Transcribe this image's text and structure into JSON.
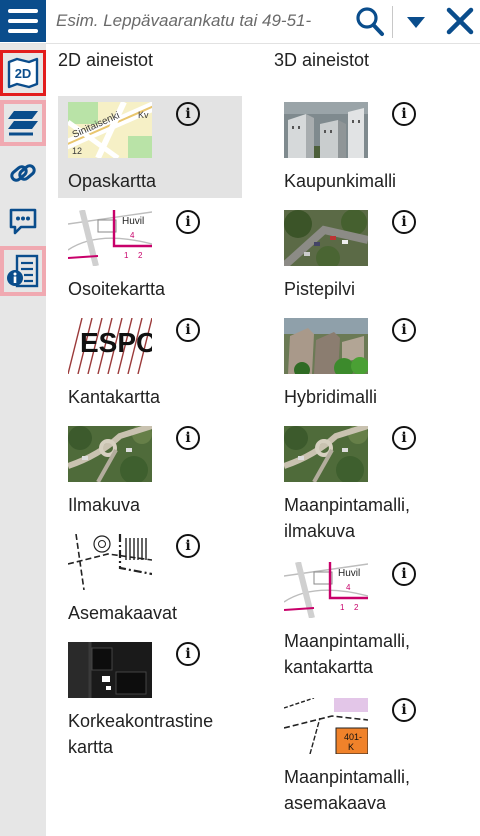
{
  "search": {
    "placeholder": "Esim. Leppävaarankatu tai 49-51-"
  },
  "icons": {
    "menu": "hamburger-menu-icon",
    "search": "magnifier-icon",
    "dropdown": "caret-down-icon",
    "close": "close-x-icon"
  },
  "sidebar": {
    "items": [
      {
        "name": "2d-map-icon",
        "glyph": "2D",
        "highlight": "red"
      },
      {
        "name": "layers-icon",
        "highlight": "pink"
      },
      {
        "name": "link-icon",
        "highlight": "none"
      },
      {
        "name": "feedback-icon",
        "highlight": "none"
      },
      {
        "name": "info-list-icon",
        "highlight": "pink"
      }
    ]
  },
  "columns": {
    "c2d_title": "2D aineistot",
    "c3d_title": "3D aineistot"
  },
  "layers_2d": [
    {
      "label": "Opaskartta",
      "selected": true,
      "thumb": "guide-map",
      "map_text": [
        "Sinitaisenki",
        "12",
        "Kv"
      ]
    },
    {
      "label": "Osoitekartta",
      "selected": false,
      "thumb": "address-map",
      "map_text": [
        "Huvil",
        "4",
        "1",
        "2"
      ]
    },
    {
      "label": "Kantakartta",
      "selected": false,
      "thumb": "base-map",
      "map_text": [
        "ESPO"
      ]
    },
    {
      "label": "Ilmakuva",
      "selected": false,
      "thumb": "aerial",
      "map_text": []
    },
    {
      "label": "Asemakaavat",
      "selected": false,
      "thumb": "zoning",
      "map_text": []
    },
    {
      "label": "Korkeakontrastine kartta",
      "selected": false,
      "thumb": "high-contrast",
      "map_text": []
    }
  ],
  "layers_3d": [
    {
      "label": "Kaupunkimalli",
      "thumb": "city-model",
      "map_text": []
    },
    {
      "label": "Pistepilvi",
      "thumb": "point-cloud",
      "map_text": []
    },
    {
      "label": "Hybridimalli",
      "thumb": "hybrid",
      "map_text": []
    },
    {
      "label": "Maanpintamalli, ilmakuva",
      "thumb": "aerial",
      "map_text": []
    },
    {
      "label": "Maanpintamalli, kantakartta",
      "thumb": "address-map",
      "map_text": [
        "Huvil",
        "4",
        "1",
        "2"
      ]
    },
    {
      "label": "Maanpintamalli, asemakaava",
      "thumb": "zoning-color",
      "map_text": [
        "401-",
        "K"
      ]
    }
  ],
  "info_glyph": "i",
  "colors": {
    "brand_blue": "#0a4d8c",
    "highlight_red": "#e21d1d",
    "highlight_pink": "#f0a9b1",
    "selected_bg": "#e3e3e3",
    "sidebar_bg": "#e6e6e6"
  }
}
